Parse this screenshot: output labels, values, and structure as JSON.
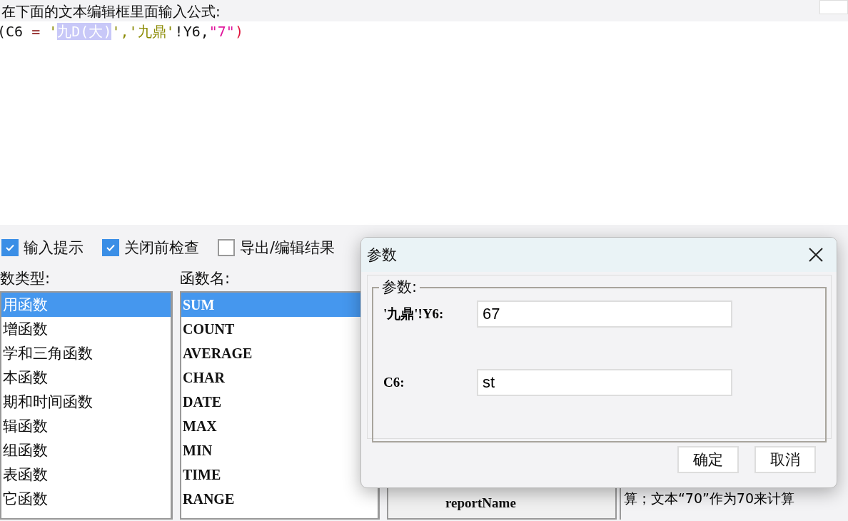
{
  "instruction": "在下面的文本编辑框里面输入公式:",
  "formula": [
    {
      "text": "(C6 ",
      "kind": "plain",
      "selected": false
    },
    {
      "text": "= ",
      "kind": "operator",
      "selected": false
    },
    {
      "text": "'",
      "kind": "string",
      "selected": false
    },
    {
      "text": "九D(大)",
      "kind": "string",
      "selected": true
    },
    {
      "text": "','九鼎'",
      "kind": "string",
      "selected": false
    },
    {
      "text": "!Y6,",
      "kind": "plain",
      "selected": false
    },
    {
      "text": "\"7\"",
      "kind": "literal",
      "selected": false
    },
    {
      "text": ")",
      "kind": "paren",
      "selected": false
    }
  ],
  "options": [
    {
      "label": "输入提示",
      "checked": true
    },
    {
      "label": "关闭前检查",
      "checked": true
    },
    {
      "label": "导出/编辑结果",
      "checked": false
    }
  ],
  "function_types": {
    "label": "数类型:",
    "items": [
      {
        "label": "用函数",
        "selected": true
      },
      {
        "label": "增函数",
        "selected": false
      },
      {
        "label": "学和三角函数",
        "selected": false
      },
      {
        "label": "本函数",
        "selected": false
      },
      {
        "label": "期和时间函数",
        "selected": false
      },
      {
        "label": "辑函数",
        "selected": false
      },
      {
        "label": "组函数",
        "selected": false
      },
      {
        "label": "表函数",
        "selected": false
      },
      {
        "label": "它函数",
        "selected": false
      }
    ]
  },
  "function_names": {
    "label": "函数名:",
    "items": [
      {
        "label": "SUM",
        "selected": true
      },
      {
        "label": "COUNT",
        "selected": false
      },
      {
        "label": "AVERAGE",
        "selected": false
      },
      {
        "label": "CHAR",
        "selected": false
      },
      {
        "label": "DATE",
        "selected": false
      },
      {
        "label": "MAX",
        "selected": false
      },
      {
        "label": "MIN",
        "selected": false
      },
      {
        "label": "TIME",
        "selected": false
      },
      {
        "label": "RANGE",
        "selected": false
      }
    ]
  },
  "tree_items": [
    "reportName"
  ],
  "description": {
    "last_line": "算；文本“70”作为70来计算"
  },
  "dialog": {
    "title": "参数",
    "group_label": "参数:",
    "fields": [
      {
        "label": "'九鼎'!Y6:",
        "value": "67"
      },
      {
        "label": "C6:",
        "value": "st"
      }
    ],
    "buttons": [
      "确定",
      "取消"
    ]
  }
}
